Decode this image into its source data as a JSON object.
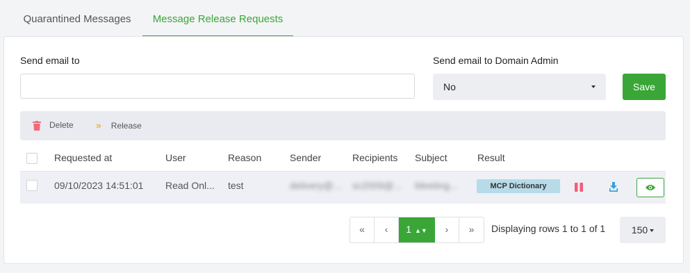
{
  "tabs": [
    {
      "label": "Quarantined Messages",
      "active": false
    },
    {
      "label": "Message Release Requests",
      "active": true
    }
  ],
  "form": {
    "send_email_label": "Send email to",
    "send_email_value": "",
    "domain_admin_label": "Send email to Domain Admin",
    "domain_admin_value": "No",
    "save_label": "Save"
  },
  "toolbar": {
    "delete_label": "Delete",
    "release_label": "Release"
  },
  "table": {
    "columns": [
      "Requested at",
      "User",
      "Reason",
      "Sender",
      "Recipients",
      "Subject",
      "Result"
    ],
    "rows": [
      {
        "requested_at": "09/10/2023 14:51:01",
        "user": "Read Onl...",
        "reason": "test",
        "sender": "delivery@...",
        "recipients": "sc2009@...",
        "subject": "Meeting...",
        "result": "MCP Dictionary"
      }
    ]
  },
  "pagination": {
    "current_page": "1",
    "rows_info": "Displaying rows 1 to 1 of 1",
    "page_size": "150"
  },
  "colors": {
    "accent": "#3aa637",
    "badge": "#b7dbe8",
    "delete_icon": "#f06a7a",
    "release_icon": "#f0b429",
    "pause_icon": "#f25c78",
    "download_icon": "#3a9fdc"
  },
  "icons": [
    "trash-icon",
    "double-chevron-right-icon",
    "pause-icon",
    "download-icon",
    "eye-icon"
  ]
}
